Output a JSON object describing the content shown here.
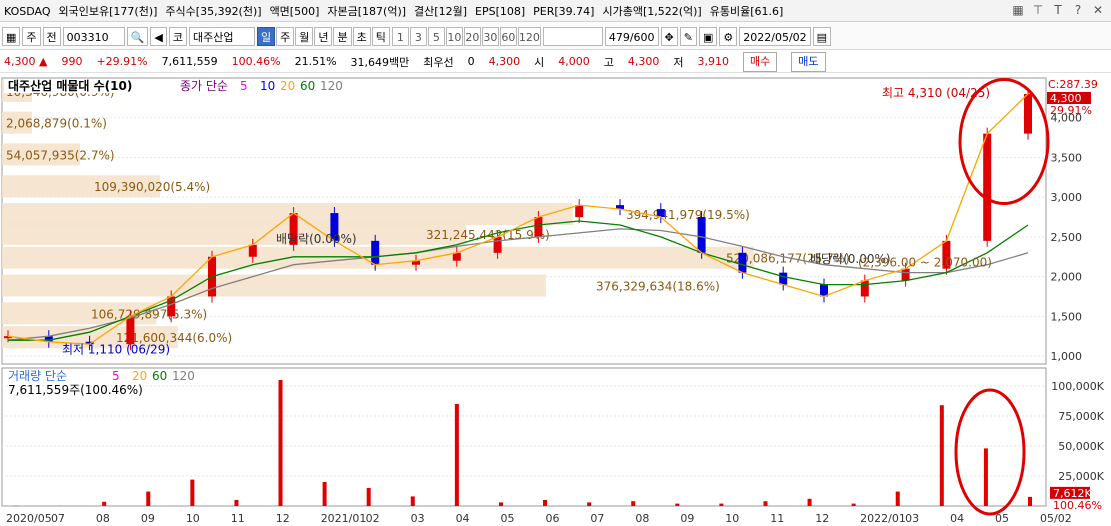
{
  "topbar": {
    "items": [
      "KOSDAQ",
      "외국인보유[177(천)]",
      "주식수[35,392(천)]",
      "액면[500]",
      "자본금[187(억)]",
      "결산[12월]",
      "EPS[108]",
      "PER[39.74]",
      "시가총액[1,522(억)]",
      "유통비율[61.6]"
    ],
    "icons": [
      "grid-icon",
      "pin-icon",
      "text-icon",
      "help-icon",
      "close-icon"
    ],
    "icon_glyphs": [
      "▦",
      "⊤",
      "T",
      "?",
      "✕"
    ]
  },
  "toolbar": {
    "period": "주",
    "type": "전",
    "code": "003310",
    "name_prefix": "코",
    "name": "대주산업",
    "tabs": [
      "일",
      "주",
      "월",
      "년",
      "분",
      "초",
      "틱"
    ],
    "selected_tab": "일",
    "minutes": [
      "1",
      "3",
      "5",
      "10",
      "20",
      "30",
      "60",
      "120"
    ],
    "count": "479",
    "total": "/600",
    "date": "2022/05/02"
  },
  "pricebar": {
    "price": "4,300",
    "change": "990",
    "change_pct": "+29.91%",
    "volume": "7,611,559",
    "volume_pct": "100.46%",
    "turnover": "21.51%",
    "amount": "31,649백만",
    "pref_label": "최우선",
    "pref_value": "0",
    "last": "4,300",
    "open_label": "시",
    "open": "4,000",
    "high_label": "고",
    "high": "4,300",
    "low_label": "저",
    "low": "3,910",
    "buy": "매수",
    "sell": "매도"
  },
  "chart_data": [
    {
      "type": "candlestick",
      "title": "대주산업 매물대 수(10)",
      "indicator_label": "종가 단순",
      "ma_periods": [
        "5",
        "10",
        "20",
        "60",
        "120"
      ],
      "ma_colors": [
        "#ff00ff",
        "#0000ff",
        "#ffa500",
        "#008000",
        "#808080"
      ],
      "dates": [
        "2020/05",
        "07",
        "08",
        "09",
        "10",
        "11",
        "12",
        "2021/01",
        "02",
        "03",
        "04",
        "05",
        "06",
        "07",
        "08",
        "09",
        "10",
        "11",
        "12",
        "2022/01",
        "03",
        "04",
        "05",
        "05/02"
      ],
      "close": [
        1250,
        1180,
        1150,
        1500,
        1750,
        2250,
        2400,
        2800,
        2450,
        2150,
        2200,
        2300,
        2500,
        2750,
        2900,
        2850,
        2750,
        2300,
        2050,
        1900,
        1750,
        1950,
        2100,
        2450,
        3800,
        4300
      ],
      "ma120": [
        1200,
        1250,
        1350,
        1480,
        1650,
        1850,
        2000,
        2150,
        2200,
        2250,
        2300,
        2380,
        2450,
        2500,
        2550,
        2600,
        2580,
        2500,
        2380,
        2250,
        2150,
        2100,
        2050,
        2050,
        2150,
        2300
      ],
      "ma60": [
        1200,
        1200,
        1300,
        1500,
        1700,
        2000,
        2150,
        2250,
        2250,
        2250,
        2300,
        2400,
        2550,
        2650,
        2700,
        2650,
        2500,
        2300,
        2150,
        2000,
        1900,
        1900,
        1950,
        2050,
        2300,
        2650
      ],
      "volume_profile": [
        {
          "label": "10,346,980(0.9%)",
          "value": 10346980,
          "price": 4300
        },
        {
          "label": "2,068,879(0.1%)",
          "value": 2068879,
          "price": 3900
        },
        {
          "label": "54,057,935(2.7%)",
          "value": 54057935,
          "price": 3500
        },
        {
          "label": "109,390,020(5.4%)",
          "value": 109390020,
          "price": 3100
        },
        {
          "label": "394,941,979(19.5%)",
          "value": 394941979,
          "price": 2750
        },
        {
          "label": "321,245,442(15.9%)",
          "value": 321245442,
          "price": 2500
        },
        {
          "label": "520,086,177(25.7%)",
          "value": 520086177,
          "price": 2200
        },
        {
          "label": "376,329,634(18.6%)",
          "value": 376329634,
          "price": 1850
        },
        {
          "label": "106,729,897(5.3%)",
          "value": 106729897,
          "price": 1500
        },
        {
          "label": "121,600,344(6.0%)",
          "value": 121600344,
          "price": 1200
        }
      ],
      "annotations": [
        {
          "text": "최고 4,310 (04/25)",
          "price": 4310
        },
        {
          "text": "최저 1,110 (06/29)",
          "price": 1110
        },
        {
          "text": "배당락(0.00%)",
          "price": 2500
        },
        {
          "text": "배당락(0.00%)",
          "price": 2250
        },
        {
          "text": "(2,396.00 ~ 2,070.00)",
          "price": 2200
        }
      ],
      "right_labels": {
        "c": "C:287.39",
        "last": "4,300",
        "pct": "29.91%"
      },
      "yticks": [
        "1,000",
        "1,500",
        "2,000",
        "2,500",
        "3,000",
        "3,500",
        "4,000"
      ],
      "ylim": [
        900,
        4500
      ]
    },
    {
      "type": "bar",
      "title": "거래량 단순",
      "ma_periods": [
        "5",
        "20",
        "60",
        "120"
      ],
      "summary": "7,611,559주(100.46%)",
      "values_k": [
        200,
        120,
        3500,
        12000,
        22000,
        5000,
        105000,
        20000,
        15000,
        8000,
        85000,
        3000,
        5000,
        3000,
        4000,
        2000,
        2000,
        4000,
        6000,
        2000,
        12000,
        84000,
        48000,
        7612
      ],
      "yticks": [
        "25,000K",
        "50,000K",
        "75,000K",
        "100,000K"
      ],
      "right_labels": {
        "last": "7,612K",
        "pct": "100.46%"
      },
      "ylim": [
        0,
        110000
      ]
    }
  ]
}
